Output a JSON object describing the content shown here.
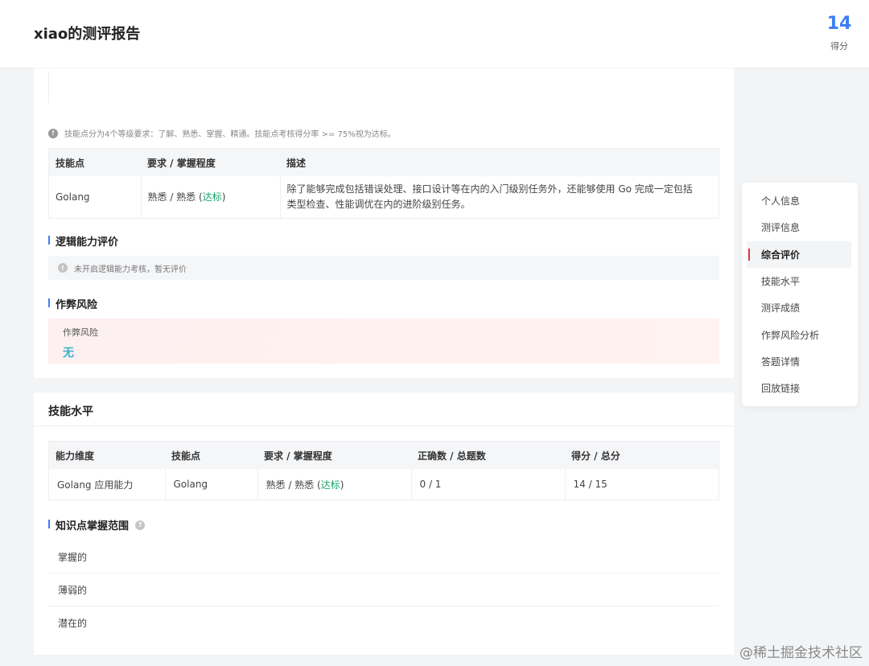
{
  "header": {
    "title": "xiao的测评报告",
    "score_value": "14",
    "score_label": "得分"
  },
  "overview": {
    "note": "技能点分为4个等级要求：了解、熟悉、掌握、精通。技能点考核得分率 >= 75%视为达标。",
    "skill_table": {
      "headers": [
        "技能点",
        "要求 / 掌握程度",
        "描述"
      ],
      "rows": [
        {
          "skill": "Golang",
          "level_prefix": "熟悉 / 熟悉 (",
          "level_status": "达标",
          "level_suffix": ")",
          "desc_line1": "除了能够完成包括错误处理、接口设计等在内的入门级别任务外，还能够使用 Go 完成一定包括",
          "desc_line2": "类型检查、性能调优在内的进阶级别任务。"
        }
      ]
    },
    "logic": {
      "title": "逻辑能力评价",
      "info": "未开启逻辑能力考核，暂无评价"
    },
    "cheat": {
      "title": "作弊风险",
      "label": "作弊风险",
      "value": "无"
    }
  },
  "skill_level": {
    "title": "技能水平",
    "table": {
      "headers": [
        "能力维度",
        "技能点",
        "要求 / 掌握程度",
        "正确数 / 总题数",
        "得分 / 总分"
      ],
      "rows": [
        {
          "dimension": "Golang 应用能力",
          "skill": "Golang",
          "level_prefix": "熟悉 / 熟悉 (",
          "level_status": "达标",
          "level_suffix": ")",
          "correct": "0 / 1",
          "score": "14 / 15"
        }
      ]
    },
    "knowledge": {
      "title": "知识点掌握范围",
      "rows": [
        "掌握的",
        "薄弱的",
        "潜在的"
      ]
    }
  },
  "side_nav": {
    "items": [
      "个人信息",
      "测评信息",
      "综合评价",
      "技能水平",
      "测评成绩",
      "作弊风险分析",
      "答题详情",
      "回放链接"
    ],
    "active_index": 2
  },
  "watermark": "@稀土掘金技术社区",
  "colors": {
    "accent": "#3d7ff2",
    "pass": "#1aa36f",
    "active_marker": "#e0393e",
    "risk_value": "#3ab0c8"
  }
}
